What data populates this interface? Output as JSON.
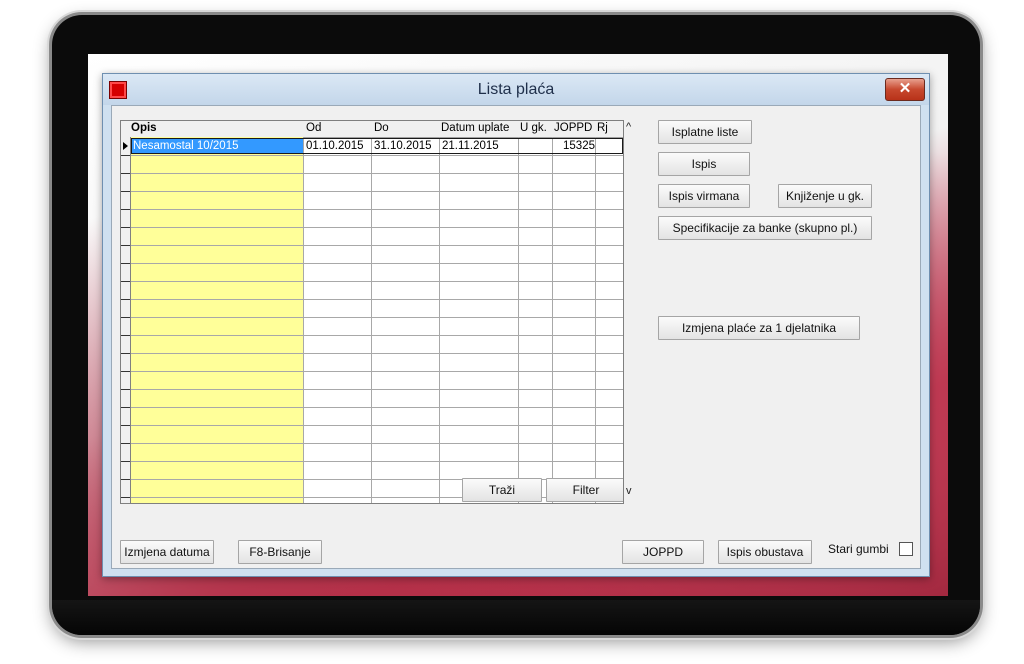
{
  "window": {
    "title": "Lista plaća",
    "close_glyph": "✕"
  },
  "grid": {
    "columns": [
      "Opis",
      "Od",
      "Do",
      "Datum uplate",
      "U gk.",
      "JOPPD",
      "Rj"
    ],
    "rows": [
      {
        "opis": "Nesamostal 10/2015",
        "od": "01.10.2015",
        "do": "31.10.2015",
        "datum_uplate": "21.11.2015",
        "u_gk": "",
        "joppd": "15325",
        "rj": ""
      }
    ],
    "scroll_up_glyph": "^",
    "scroll_down_glyph": "v"
  },
  "buttons": {
    "isplatne_liste": "Isplatne liste",
    "ispis": "Ispis",
    "ispis_virmana": "Ispis virmana",
    "knjizenje": "Knjiženje u gk.",
    "specifikacije": "Specifikacije za banke (skupno pl.)",
    "izmjena_place": "Izmjena plaće za 1 djelatnika",
    "trazi": "Traži",
    "filter": "Filter",
    "izmjena_datuma": "Izmjena datuma",
    "brisanje": "F8-Brisanje",
    "joppd": "JOPPD",
    "ispis_obustava": "Ispis obustava"
  },
  "options": {
    "stari_gumbi_label": "Stari gumbi",
    "stari_gumbi_checked": false
  },
  "colors": {
    "accent_title": "#c3d6ea",
    "selection": "#3399ff",
    "highlight_column": "#ffff99",
    "close_button": "#c7482e"
  },
  "icons": {
    "app": "red-square-icon",
    "close": "close-icon"
  }
}
